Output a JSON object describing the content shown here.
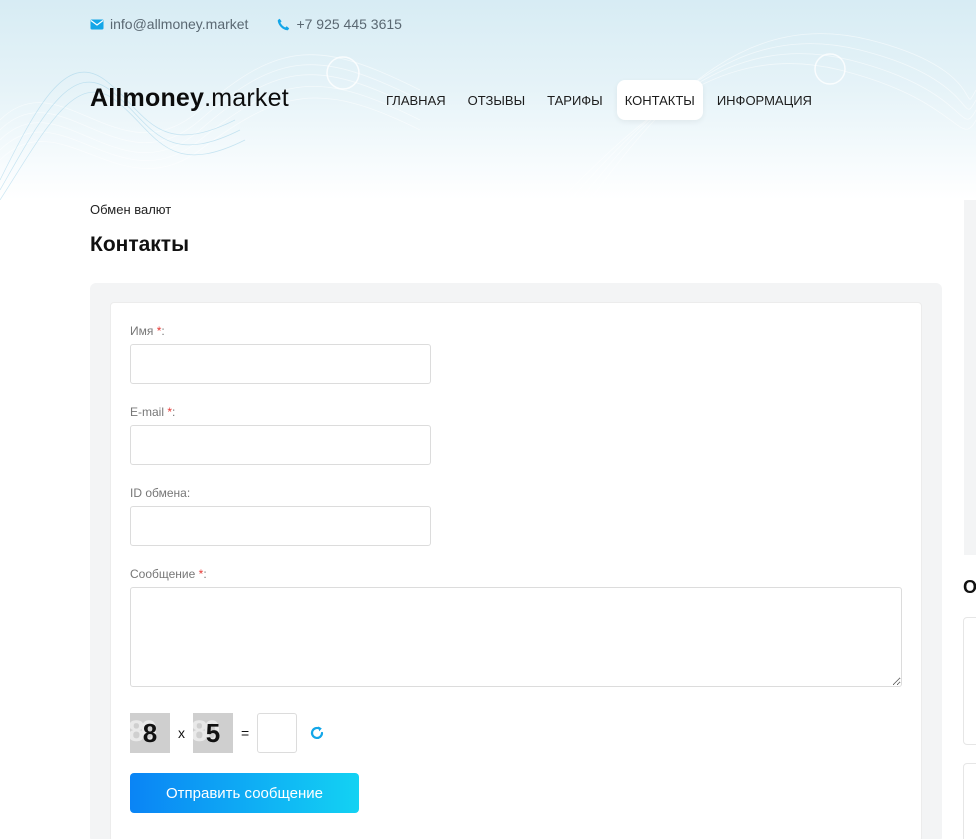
{
  "topbar": {
    "email": "info@allmoney.market",
    "phone": "+7 925 445 3615",
    "email_icon": "envelope-icon",
    "phone_icon": "phone-icon"
  },
  "logo": {
    "bold": "Allmoney",
    "rest": ".market"
  },
  "nav": {
    "items": [
      {
        "label": "ГЛАВНАЯ",
        "active": false
      },
      {
        "label": "ОТЗЫВЫ",
        "active": false
      },
      {
        "label": "ТАРИФЫ",
        "active": false
      },
      {
        "label": "КОНТАКТЫ",
        "active": true
      },
      {
        "label": "ИНФОРМАЦИЯ",
        "active": false
      }
    ]
  },
  "breadcrumb": "Обмен валют",
  "page_title": "Контакты",
  "form": {
    "name_label": "Имя",
    "email_label": "E-mail",
    "exchange_id_label": "ID обмена:",
    "message_label": "Сообщение",
    "required_mark": "*",
    "colon": ":",
    "name_value": "",
    "email_value": "",
    "exchange_id_value": "",
    "message_value": "",
    "captcha": {
      "a": "8",
      "op": "x",
      "b": "5",
      "eq": "=",
      "answer": "",
      "refresh_icon": "refresh-icon"
    },
    "submit_label": "Отправить сообщение"
  },
  "sidebar": {
    "heading_fragment": "О"
  },
  "colors": {
    "accent_start": "#0a84f5",
    "accent_end": "#13d2f3",
    "required": "#e53935",
    "icon_blue": "#13a6e8"
  }
}
